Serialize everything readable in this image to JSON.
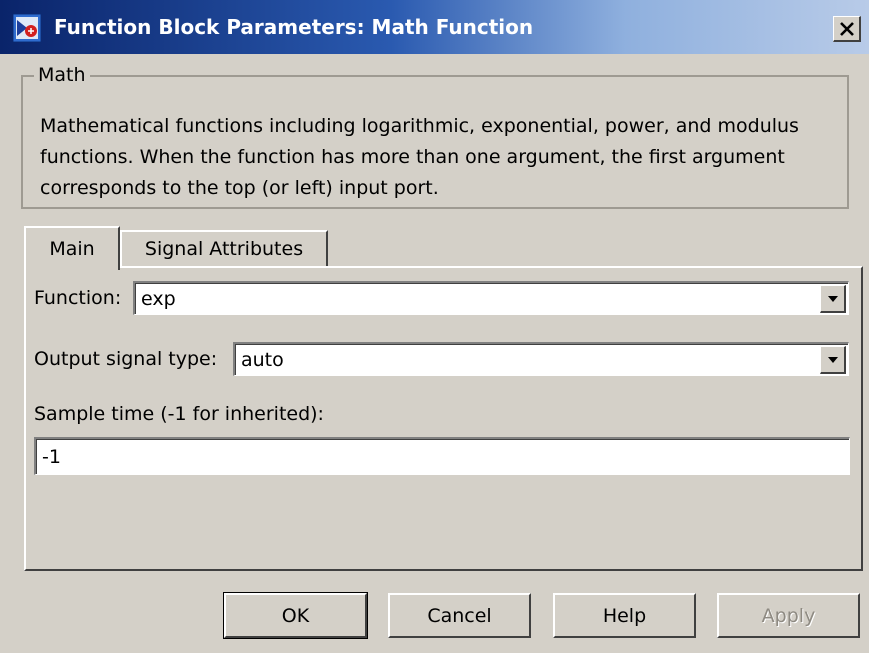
{
  "window": {
    "title": "Function Block Parameters: Math Function",
    "close_symbol": "✕",
    "icon": "simulink-block-icon"
  },
  "group": {
    "legend": "Math",
    "description_lines": [
      "Mathematical functions including logarithmic, exponential, power, and modulus",
      "functions.  When the function has more than one argument, the first argument",
      "corresponds to the top (or left) input port."
    ]
  },
  "tabs": [
    {
      "label": "Main",
      "active": true
    },
    {
      "label": "Signal Attributes",
      "active": false
    }
  ],
  "main": {
    "function": {
      "label": "Function:",
      "value": "exp"
    },
    "output_signal_type": {
      "label": "Output signal type:",
      "value": "auto"
    },
    "sample_time": {
      "label": "Sample time (-1 for inherited):",
      "value": "-1"
    }
  },
  "buttons": {
    "ok": "OK",
    "cancel": "Cancel",
    "help": "Help",
    "apply": "Apply"
  },
  "colors": {
    "title_start": "#0a246a",
    "title_end": "#b8cbe8",
    "face": "#d4d0c8",
    "disabled_text": "#8e8a82"
  }
}
